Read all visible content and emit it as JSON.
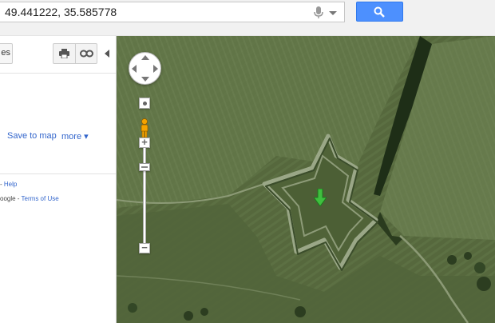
{
  "search": {
    "query": "49.441222, 35.585778"
  },
  "panel": {
    "tab_fragment": "es",
    "save_to_map": "Save to map",
    "more": "more ▾",
    "footer_dash": "-",
    "help": "Help",
    "google_fragment": "oogle -",
    "terms": "Terms of Use"
  },
  "icons": {
    "mic": "microphone-icon",
    "search": "magnifier-icon",
    "print": "print-icon",
    "link": "link-icon",
    "pegman": "pegman-icon",
    "marker": "green-arrow-marker-icon"
  },
  "colors": {
    "search_button": "#4d90fe",
    "link": "#3366cc",
    "marker": "#3fbf3f",
    "pegman": "#f4a300"
  }
}
